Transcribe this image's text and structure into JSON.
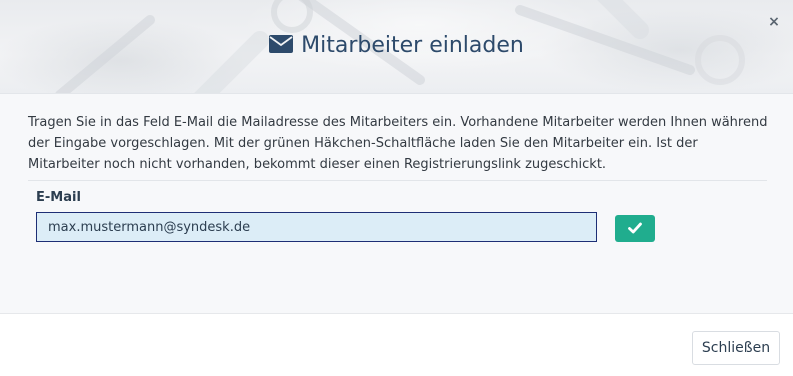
{
  "dialog": {
    "title": "Mitarbeiter einladen",
    "title_icon": "envelope-icon",
    "close_symbol": "×"
  },
  "body": {
    "help_text": "Tragen Sie in das Feld E-Mail die Mailadresse des Mitarbeiters ein. Vorhandene Mitarbeiter werden Ihnen während der Eingabe vorgeschlagen. Mit der grünen Häkchen-Schaltfläche laden Sie den Mitarbeiter ein. Ist der Mitarbeiter noch nicht vorhanden, bekommt dieser einen Registrierungslink zugeschickt.",
    "email": {
      "label": "E-Mail",
      "value": "max.mustermann@syndesk.de"
    },
    "submit_icon": "check-icon"
  },
  "footer": {
    "close_label": "Schließen"
  },
  "colors": {
    "accent": "#20ad8e",
    "title": "#2d4a6b",
    "input_background": "#dcedf7",
    "input_border": "#1d2e75"
  }
}
